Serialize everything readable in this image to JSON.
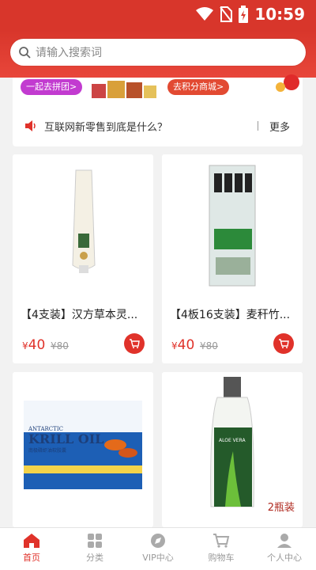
{
  "status_bar": {
    "time": "10:59"
  },
  "search": {
    "placeholder": "请输入搜索词"
  },
  "promo": {
    "group_buy_label": "一起去拼团>",
    "points_mall_label": "去积分商城>"
  },
  "news": {
    "headline": "互联网新零售到底是什么？",
    "more_label": "更多"
  },
  "products": [
    {
      "title": "【4支装】汉方草本灵...",
      "price": "40",
      "original_price": "¥80",
      "currency": "¥"
    },
    {
      "title": "【4板16支装】麦秆竹...",
      "price": "40",
      "original_price": "¥80",
      "currency": "¥"
    },
    {
      "title": "",
      "image_text": [
        "ANTARCTIC",
        "KRILL OIL",
        "南极磷虾油软胶囊"
      ]
    },
    {
      "title": "",
      "badge": "2瓶装",
      "image_text": [
        "ALOE VERA"
      ]
    }
  ],
  "tabbar": {
    "tabs": [
      {
        "label": "首页",
        "icon": "home-icon",
        "active": true
      },
      {
        "label": "分类",
        "icon": "grid-icon",
        "active": false
      },
      {
        "label": "VIP中心",
        "icon": "compass-icon",
        "active": false
      },
      {
        "label": "购物车",
        "icon": "cart-icon",
        "active": false
      },
      {
        "label": "个人中心",
        "icon": "person-icon",
        "active": false
      }
    ]
  },
  "colors": {
    "brand_red": "#d8362b",
    "price_red": "#e0322a",
    "inactive_gray": "#999999"
  }
}
